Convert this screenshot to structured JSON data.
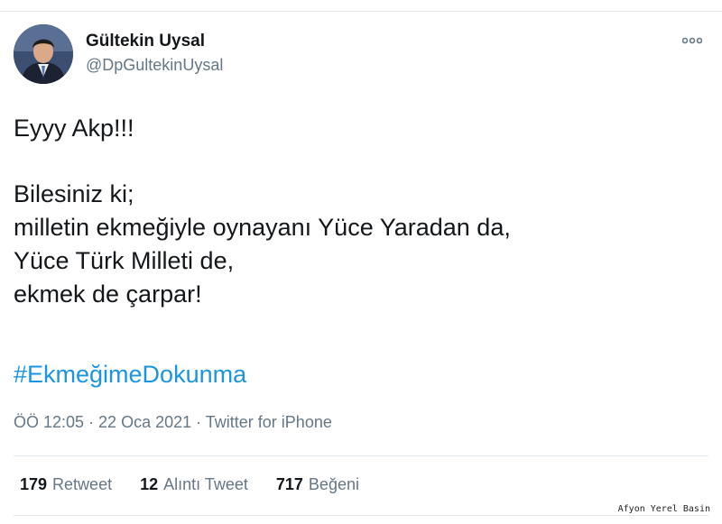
{
  "user": {
    "name": "Gültekin Uysal",
    "handle": "@DpGultekinUysal"
  },
  "tweet": {
    "lines": [
      "Eyyy Akp!!!",
      "Bilesiniz ki;",
      "milletin ekmeğiyle oynayanı Yüce Yaradan da,",
      "Yüce Türk Milleti de,",
      "ekmek de çarpar!"
    ],
    "hashtag": "#EkmeğimeDokunma",
    "meta": "ÖÖ 12:05 · 22 Oca 2021 · Twitter for iPhone"
  },
  "stats": {
    "retweets_count": "179",
    "retweets_label": "Retweet",
    "quotes_count": "12",
    "quotes_label": "Alıntı Tweet",
    "likes_count": "717",
    "likes_label": "Beğeni"
  },
  "watermark": "Afyon Yerel Basin",
  "icons": {
    "more": "more-dots-icon",
    "avatar": "profile-photo"
  },
  "colors": {
    "link": "#1b95e0",
    "secondary": "#657786",
    "text": "#14171a"
  }
}
